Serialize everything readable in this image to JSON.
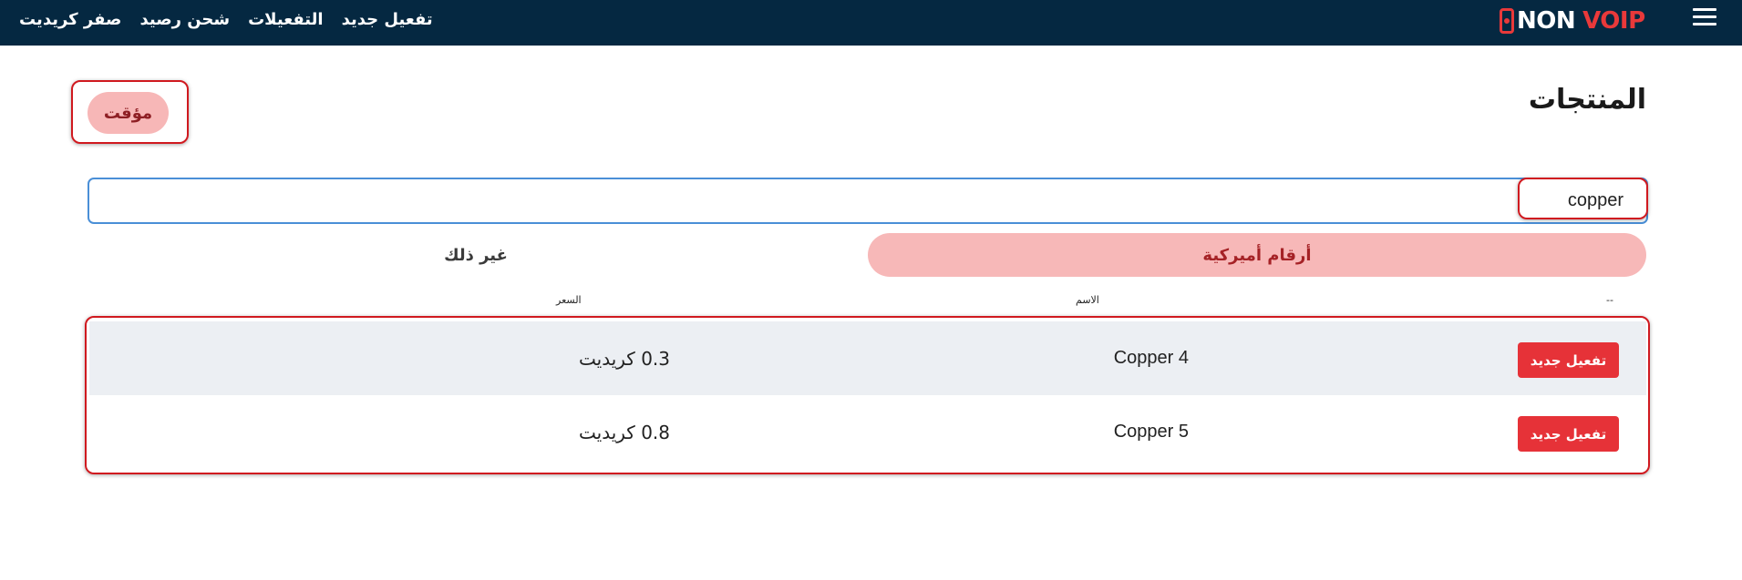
{
  "topbar": {
    "logo_left": "NON",
    "logo_right": "VOIP",
    "nav": [
      "صفر كريديت",
      "شحن رصيد",
      "التفعيلات",
      "تفعيل جديد"
    ]
  },
  "page": {
    "title": "المنتجات",
    "temp_button": "مؤقت"
  },
  "search": {
    "value": "copper"
  },
  "tabs": {
    "us_numbers": "أرقام أميركية",
    "other": "غير ذلك"
  },
  "table": {
    "headers": {
      "action": "--",
      "name": "الاسم",
      "price": "السعر"
    },
    "rows": [
      {
        "action": "تفعيل جديد",
        "name": "Copper 4",
        "price": "0.3 كريديت"
      },
      {
        "action": "تفعيل جديد",
        "name": "Copper 5",
        "price": "0.8 كريديت"
      }
    ]
  },
  "colors": {
    "nav_bg": "#052841",
    "brand_red": "#e9393a",
    "pill_pink": "#f7b7b7",
    "action_red": "#e63238"
  }
}
